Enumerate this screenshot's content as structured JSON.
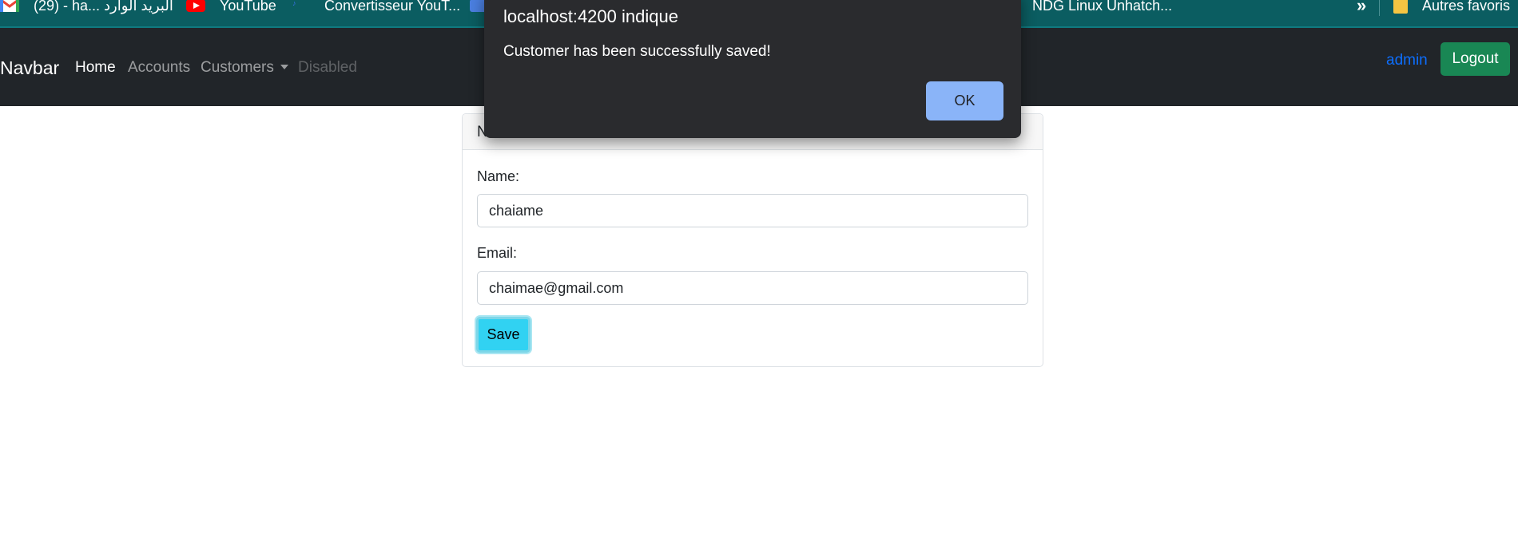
{
  "bookmarks": {
    "items": [
      {
        "icon": "gmail-icon",
        "label": "(29) - ha... البريد الوارد"
      },
      {
        "icon": "youtube-icon",
        "label": "YouTube"
      },
      {
        "icon": "mp3-icon",
        "label": "Convertisseur YouT..."
      },
      {
        "icon": "google-icon",
        "label": ""
      },
      {
        "icon": "",
        "label": "NDG Linux Unhatch..."
      }
    ],
    "overflow_label": "»",
    "other_favorites_label": "Autres favoris"
  },
  "navbar": {
    "brand": "Navbar",
    "links": [
      "Home",
      "Accounts",
      "Customers",
      "Disabled"
    ],
    "user": "admin",
    "logout_label": "Logout"
  },
  "form": {
    "header": "N",
    "name_label": "Name:",
    "name_value": "chaiame",
    "email_label": "Email:",
    "email_value": "chaimae@gmail.com",
    "save_label": "Save"
  },
  "dialog": {
    "title": "localhost:4200 indique",
    "message": "Customer has been successfully saved!",
    "ok_label": "OK"
  },
  "colors": {
    "bookmarks_bg": "#0b5d61",
    "navbar_bg": "#212529",
    "logout_bg": "#198754",
    "save_bg": "#31d2f2",
    "dialog_bg": "#2a2b2e",
    "ok_bg": "#8ab4f8",
    "link_color": "#0d6efd"
  }
}
